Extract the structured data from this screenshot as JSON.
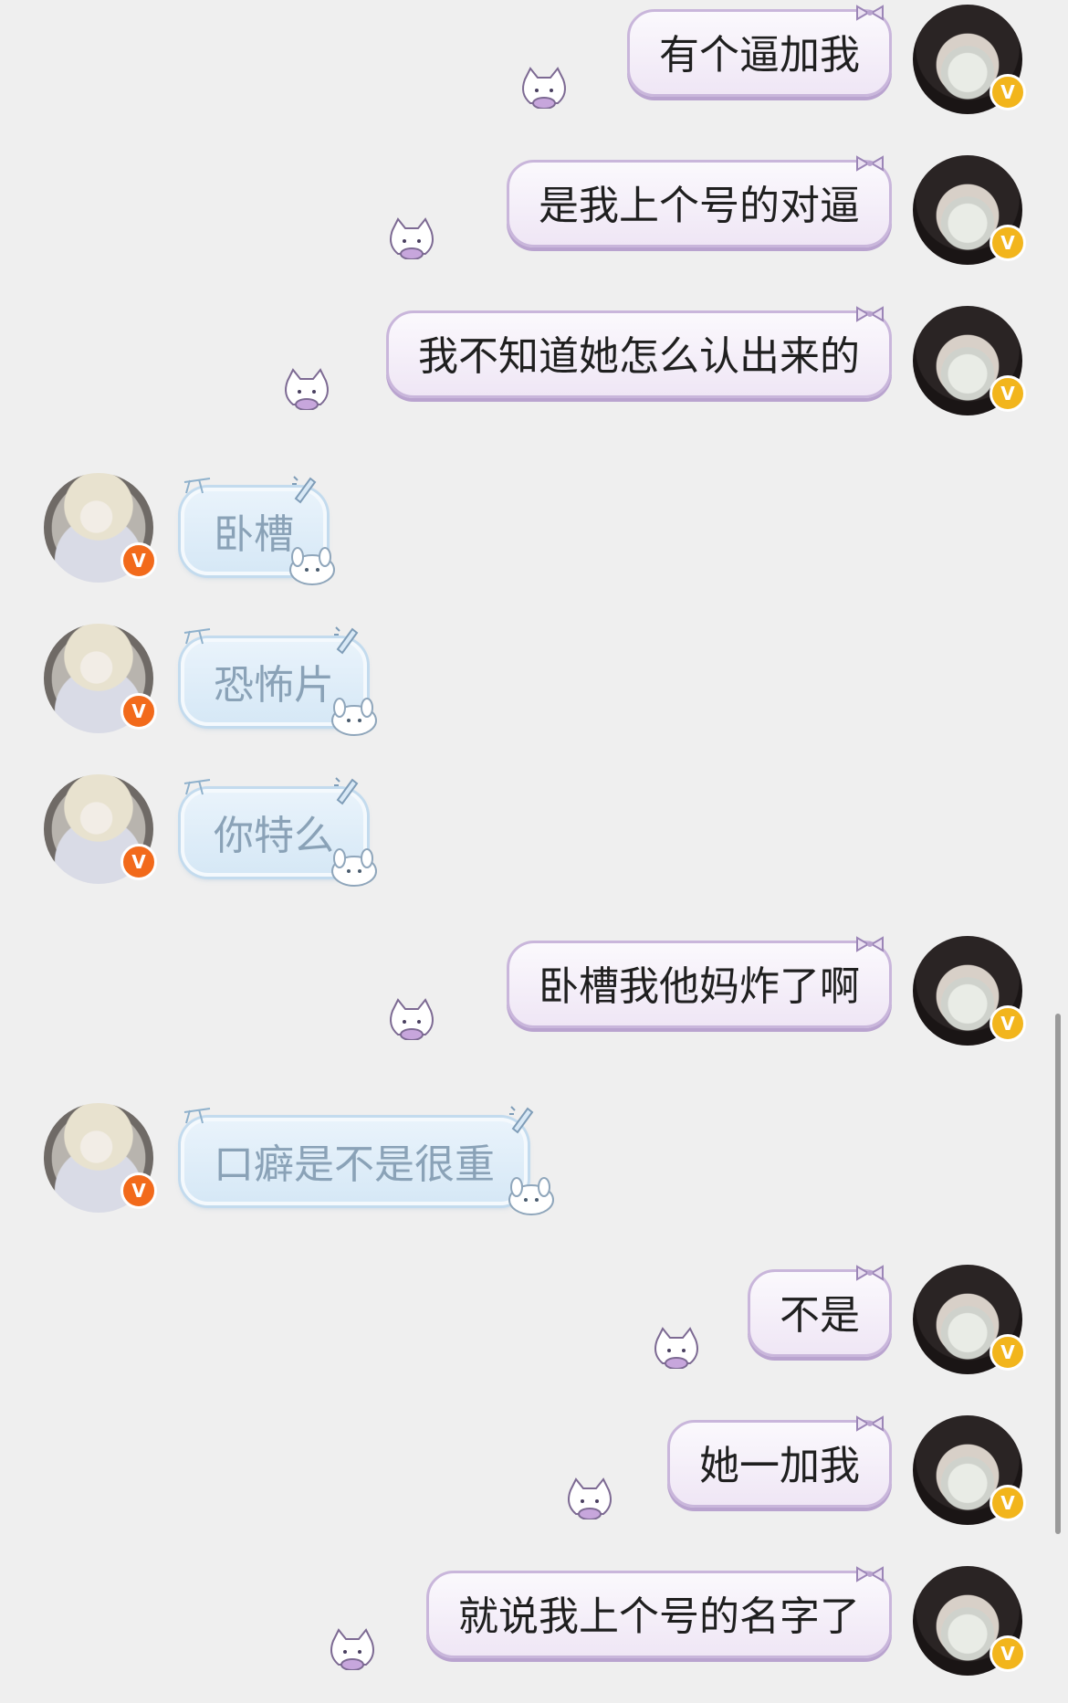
{
  "conversation": {
    "messages": [
      {
        "sender": "me",
        "text": "有个逼加我"
      },
      {
        "sender": "me",
        "text": "是我上个号的对逼"
      },
      {
        "sender": "me",
        "text": "我不知道她怎么认出来的"
      },
      {
        "sender": "other",
        "text": "卧槽"
      },
      {
        "sender": "other",
        "text": "恐怖片"
      },
      {
        "sender": "other",
        "text": "你特么"
      },
      {
        "sender": "me",
        "text": "卧槽我他妈炸了啊"
      },
      {
        "sender": "other",
        "text": "口癖是不是很重"
      },
      {
        "sender": "me",
        "text": "不是"
      },
      {
        "sender": "me",
        "text": "她一加我"
      },
      {
        "sender": "me",
        "text": "就说我上个号的名字了"
      }
    ]
  },
  "badges": {
    "verified_letter": "V"
  },
  "colors": {
    "background": "#efefef",
    "my_bubble_border": "#c9b6db",
    "other_bubble_bg": "#d6e8f6",
    "other_text": "#8aa2b7",
    "my_badge": "#f2b51c",
    "other_badge": "#f26a1b"
  },
  "icons": {
    "my_bubble_decoration": "cat-with-bow-icon",
    "other_bubble_decoration": "bunny-with-pen-icon"
  }
}
